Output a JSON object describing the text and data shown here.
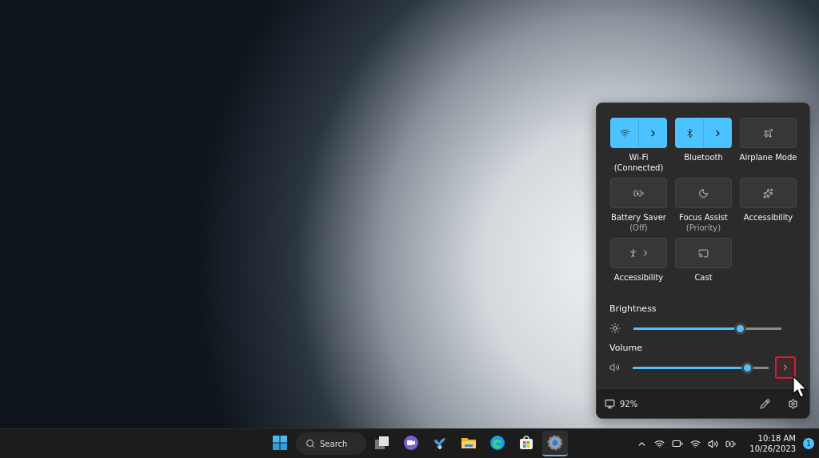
{
  "quick_settings": {
    "tiles": [
      {
        "kind": "wifi",
        "label": "Wi-Fi",
        "sublabel": "(Connected)",
        "on": true,
        "chevron": true
      },
      {
        "kind": "bluetooth",
        "label": "Bluetooth",
        "on": true,
        "chevron": true
      },
      {
        "kind": "airplane",
        "label": "Airplane Mode",
        "on": false,
        "chevron": false
      },
      {
        "kind": "battery",
        "label": "Battery Saver",
        "sublabel": "(Off)",
        "on": false,
        "chevron": false
      },
      {
        "kind": "moon",
        "label": "Focus Assist",
        "sublabel": "(Priority)",
        "on": false,
        "chevron": false
      },
      {
        "kind": "sparkle",
        "label": "Accessibility",
        "on": false,
        "chevron": false
      },
      {
        "kind": "person",
        "label": "Accessibility",
        "on": false,
        "chevron": true
      },
      {
        "kind": "cast",
        "label": "Cast",
        "on": false,
        "chevron": false
      }
    ],
    "sliders": [
      {
        "kind": "sun",
        "label": "Brightness",
        "level": 0.72
      },
      {
        "kind": "speaker",
        "label": "Volume",
        "level": 0.84,
        "expand_button": {
          "highlighted": true
        }
      }
    ],
    "footer": {
      "battery": "92%"
    }
  },
  "taskbar": {
    "search": "Search",
    "apps": [
      {
        "kind": "start",
        "selected": false
      },
      {
        "kind": "taskview",
        "selected": false
      },
      {
        "kind": "chat",
        "selected": false
      },
      {
        "kind": "bird",
        "selected": false
      },
      {
        "kind": "folder",
        "selected": false
      },
      {
        "kind": "edge",
        "selected": false
      },
      {
        "kind": "store",
        "selected": false
      },
      {
        "kind": "settings",
        "selected": true
      }
    ],
    "tray": {
      "time": "10:18 AM",
      "date": "10/26/2023",
      "notifications": "1"
    }
  }
}
